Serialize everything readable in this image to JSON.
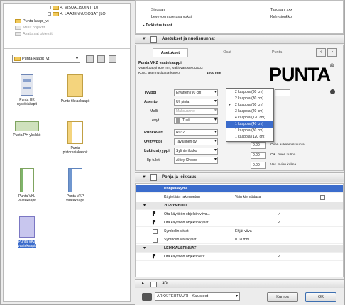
{
  "tree": {
    "items": [
      {
        "label": "4. VISUALISOINTI 10",
        "muted": false
      },
      {
        "label": "4. LAAJENNUSOSAT (LO",
        "muted": false
      },
      {
        "label": "Punta-kaapi_vt",
        "muted": false
      },
      {
        "label": "Muut objektit",
        "muted": true
      },
      {
        "label": "Avattavat objektit",
        "muted": true
      }
    ]
  },
  "library": {
    "folder_combo": "Punta-kaapit_vt",
    "items": [
      {
        "label": "Punta HK\nnystökkäapit",
        "thumb": "cabinet-blue"
      },
      {
        "label": "Punta tikkaskaapit",
        "thumb": "cabinet-yellow"
      },
      {
        "label": "Punta PH yksikkö",
        "thumb": "cabinet-green-low"
      },
      {
        "label": "Punta\npistorasiakaapit",
        "thumb": "cabinet-yellow-open"
      },
      {
        "label": "Punta VKL\nvaatekaapit",
        "thumb": "cabinet-green"
      },
      {
        "label": "Punta VKP\nvaatekaapit",
        "thumb": "cabinet-blue-open"
      },
      {
        "label": "Punta VKZ\nvaatekaapit",
        "thumb": "cabinet-purple",
        "selected": true
      }
    ]
  },
  "top_rows": [
    {
      "k": "Sivuaani",
      "v": "Tasoaani xxx"
    },
    {
      "k": "Leveyden asetusarvoksi",
      "v": "Kehysjoukko"
    }
  ],
  "sections": {
    "layers": "Tarkistus tasot",
    "settings": "Asetukset ja nuolisuunnat",
    "props": "Pohja ja leikkaus",
    "bottom": "3D"
  },
  "tabs": [
    "Asetukset",
    "Osat",
    "Punta"
  ],
  "product": {
    "title": "Punta VKZ vaatekaappi",
    "line1": "Vaatekaappi 900 mm, Vakiovarustelu 2002",
    "line2": "Koko, asennuslaatta-kotelo",
    "line2_value": "1000 mm",
    "logo": "PUNTA"
  },
  "form": [
    {
      "label": "Tyyppi",
      "value": "Eivarren (90 cm)"
    },
    {
      "label": "Asento",
      "value": "Ul. pinta"
    },
    {
      "label": "Malli",
      "value": "Maksuanne"
    },
    {
      "label": "Levyt",
      "value": "Tuuli..."
    },
    {
      "label": "Runkoväri",
      "value": "R032"
    },
    {
      "label": "Ovityyppi",
      "value": "Tavallinen ovi"
    },
    {
      "label": "Lukitustyyppi",
      "value": "Sylinterilukko"
    },
    {
      "label": "Ilp tulot",
      "value": "Akiey Chevro"
    }
  ],
  "dropdown_options": [
    {
      "label": "2 kaappia (30 cm)",
      "checked": false,
      "selected": false
    },
    {
      "label": "2 kaappia (30 cm)",
      "checked": false,
      "selected": false
    },
    {
      "label": "2 kaappia (30 cm)",
      "checked": true,
      "selected": false
    },
    {
      "label": "3 kaappia (20 cm)",
      "checked": false,
      "selected": false
    },
    {
      "label": "4 kaappia (120 cm)",
      "checked": false,
      "selected": false
    },
    {
      "label": "1 kaappia (40 cm)",
      "checked": false,
      "selected": true
    },
    {
      "label": "1 kaappia (80 cm)",
      "checked": false,
      "selected": false
    },
    {
      "label": "1 kaappia (120 cm)",
      "checked": false,
      "selected": false
    }
  ],
  "right_fields": [
    {
      "label": "Oven aukeamissuunta",
      "value": "0.00"
    },
    {
      "label": "Oik. ovien kulma",
      "value": "0.00"
    },
    {
      "label": "Vas. ovien kulma",
      "value": "0.00"
    }
  ],
  "prop_rows": [
    {
      "type": "hl",
      "label": "Pohjanäkymä"
    },
    {
      "type": "row",
      "label": "Käytetään rakennetun",
      "value": "Vain kiemtätasa"
    },
    {
      "type": "grp",
      "label": "2D-SYMBOLI"
    },
    {
      "type": "row",
      "label": "Ota käyttöön objektin viiva...",
      "value": "✓"
    },
    {
      "type": "row",
      "label": "Ota käyttöön objektin kynät",
      "value": "✓"
    },
    {
      "type": "row",
      "label": "Symbolin viivat",
      "value": "Ehjät viiva"
    },
    {
      "type": "row",
      "label": "Symbolin viivakynät",
      "value": "0.18 mm"
    },
    {
      "type": "grp",
      "label": "LEIKKAUSPINNAT"
    },
    {
      "type": "row",
      "label": "Ota käyttöön objektin erit...",
      "value": "✓"
    }
  ],
  "footer": {
    "layer": "ARKKITEHTUURI - Kalusteet",
    "cancel": "Kumoa",
    "ok": "OK"
  }
}
